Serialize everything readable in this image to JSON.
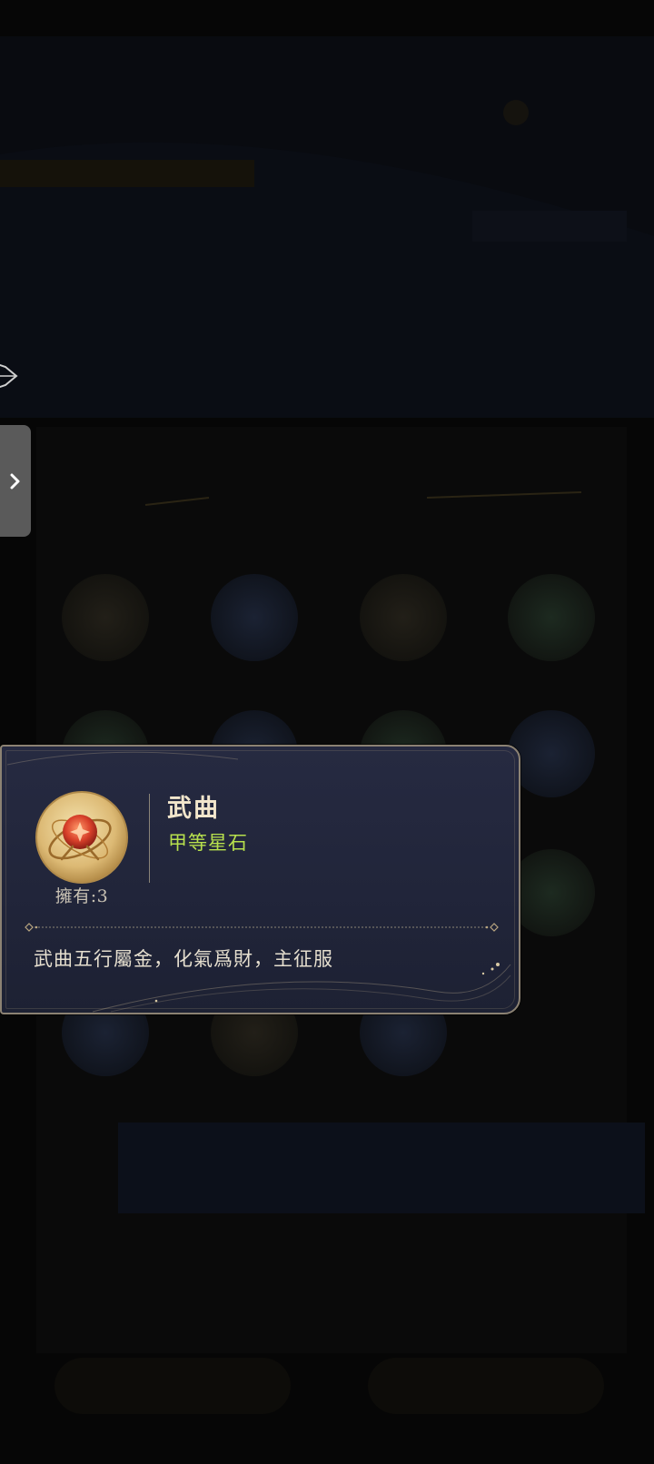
{
  "background": {
    "banner_title": "",
    "overlay_color": "#000000"
  },
  "side_tab": {
    "icon": "chevron-right-icon"
  },
  "item_card": {
    "name": "武曲",
    "grade": "甲等星石",
    "owned_label": "擁有:3",
    "description": "武曲五行屬金，化氣爲財，主征服",
    "icon": "star-stone-orb-icon",
    "colors": {
      "name": "#f2e6cc",
      "grade": "#b7e04d",
      "description": "#e6dfcf",
      "panel": "#242840",
      "border": "#8c8273"
    }
  }
}
